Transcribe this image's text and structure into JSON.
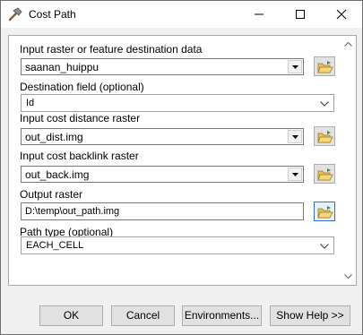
{
  "window": {
    "title": "Cost Path"
  },
  "fields": {
    "input_raster": {
      "label": "Input raster or feature destination data",
      "value": "saanan_huippu"
    },
    "destination_field": {
      "label": "Destination field (optional)",
      "value": "Id"
    },
    "cost_distance": {
      "label": "Input cost distance raster",
      "value": "out_dist.img"
    },
    "cost_backlink": {
      "label": "Input cost backlink raster",
      "value": "out_back.img"
    },
    "output_raster": {
      "label": "Output raster",
      "value": "D:\\temp\\out_path.img"
    },
    "path_type": {
      "label": "Path type (optional)",
      "value": "EACH_CELL"
    }
  },
  "buttons": {
    "ok": "OK",
    "cancel": "Cancel",
    "environments": "Environments...",
    "show_help": "Show Help >>"
  }
}
